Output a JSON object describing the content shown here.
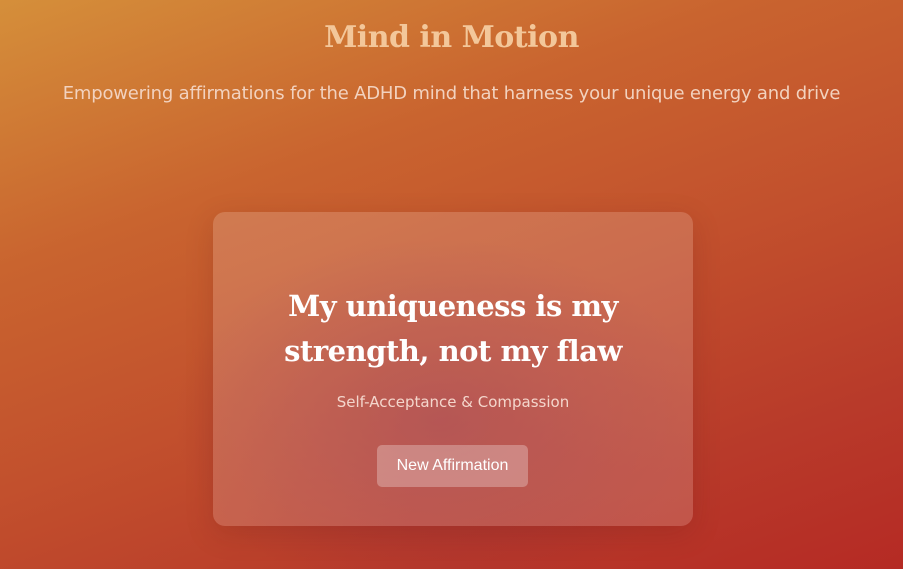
{
  "header": {
    "title": "Mind in Motion",
    "subtitle": "Empowering affirmations for the ADHD mind that harness your unique energy and drive"
  },
  "card": {
    "affirmation": "My uniqueness is my strength, not my flaw",
    "category": "Self-Acceptance & Compassion",
    "button_label": "New Affirmation"
  },
  "colors": {
    "title": "#f3c79a",
    "background_top": "#d58f3a",
    "background_bottom": "#b52a24"
  }
}
